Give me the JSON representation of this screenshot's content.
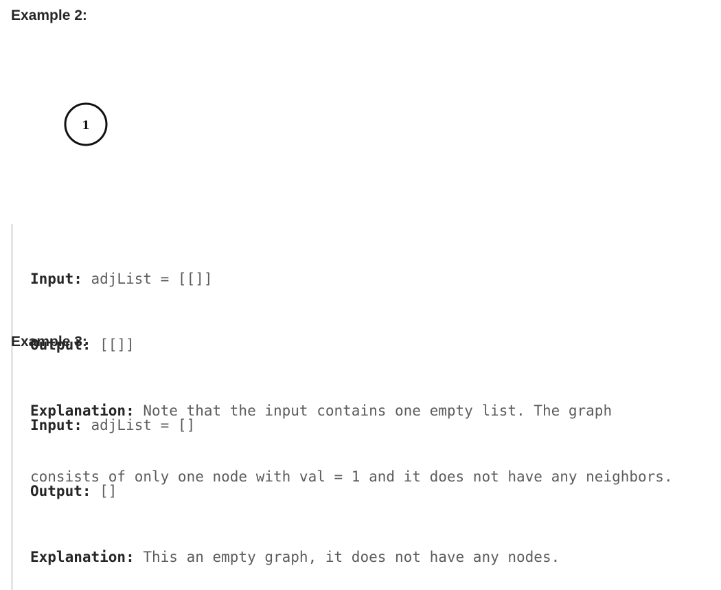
{
  "example2": {
    "title": "Example 2:",
    "graph": {
      "nodes": [
        {
          "label": "1"
        }
      ]
    },
    "input_label": "Input:",
    "input_value": " adjList = [[]]",
    "output_label": "Output:",
    "output_value": " [[]]",
    "explanation_label": "Explanation:",
    "explanation_line1": " Note that the input contains one empty list. The graph",
    "explanation_line2": "consists of only one node with val = 1 and it does not have any neighbors."
  },
  "example3": {
    "title": "Example 3:",
    "input_label": "Input:",
    "input_value": " adjList = []",
    "output_label": "Output:",
    "output_value": " []",
    "explanation_label": "Explanation:",
    "explanation_value": " This an empty graph, it does not have any nodes."
  }
}
